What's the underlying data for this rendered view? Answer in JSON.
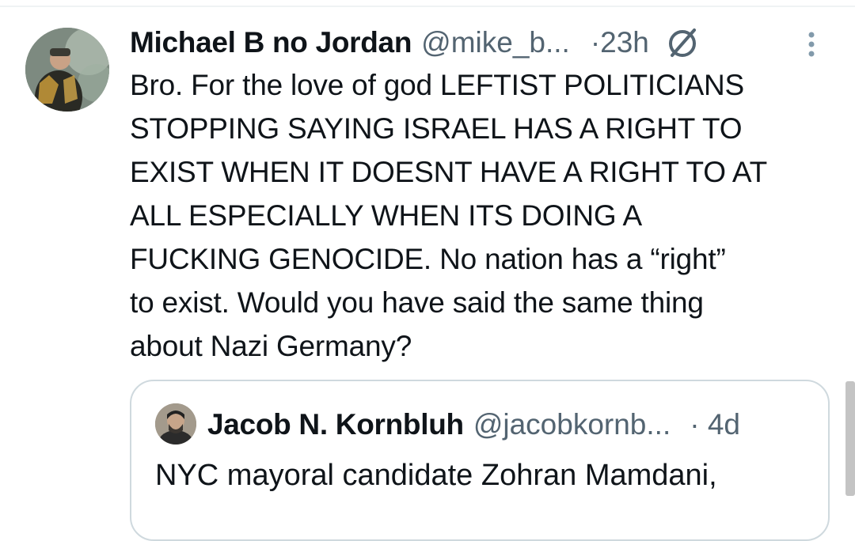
{
  "tweet": {
    "author_name": "Michael B no Jordan",
    "author_handle": "@mike_b...",
    "time": "·23h",
    "time_icon": "no-symbol-icon",
    "more_icon": "vertical-ellipsis-icon",
    "text": "Bro. For the love of god LEFTIST POLITICIANS\nSTOPPING SAYING ISRAEL HAS A RIGHT TO\nEXIST WHEN IT DOESNT HAVE A RIGHT TO AT\nALL ESPECIALLY WHEN ITS DOING A\nFUCKING GENOCIDE. No nation has a “right”\nto exist. Would you have said the same thing\nabout Nazi Germany?"
  },
  "quote": {
    "author_name": "Jacob N. Kornbluh",
    "author_handle": "@jacobkornb...",
    "time": "· 4d",
    "text": "NYC mayoral candidate Zohran Mamdani,"
  },
  "colors": {
    "text": "#0f1419",
    "secondary": "#536471",
    "border": "#cfd9de",
    "divider": "#eff3f4"
  }
}
